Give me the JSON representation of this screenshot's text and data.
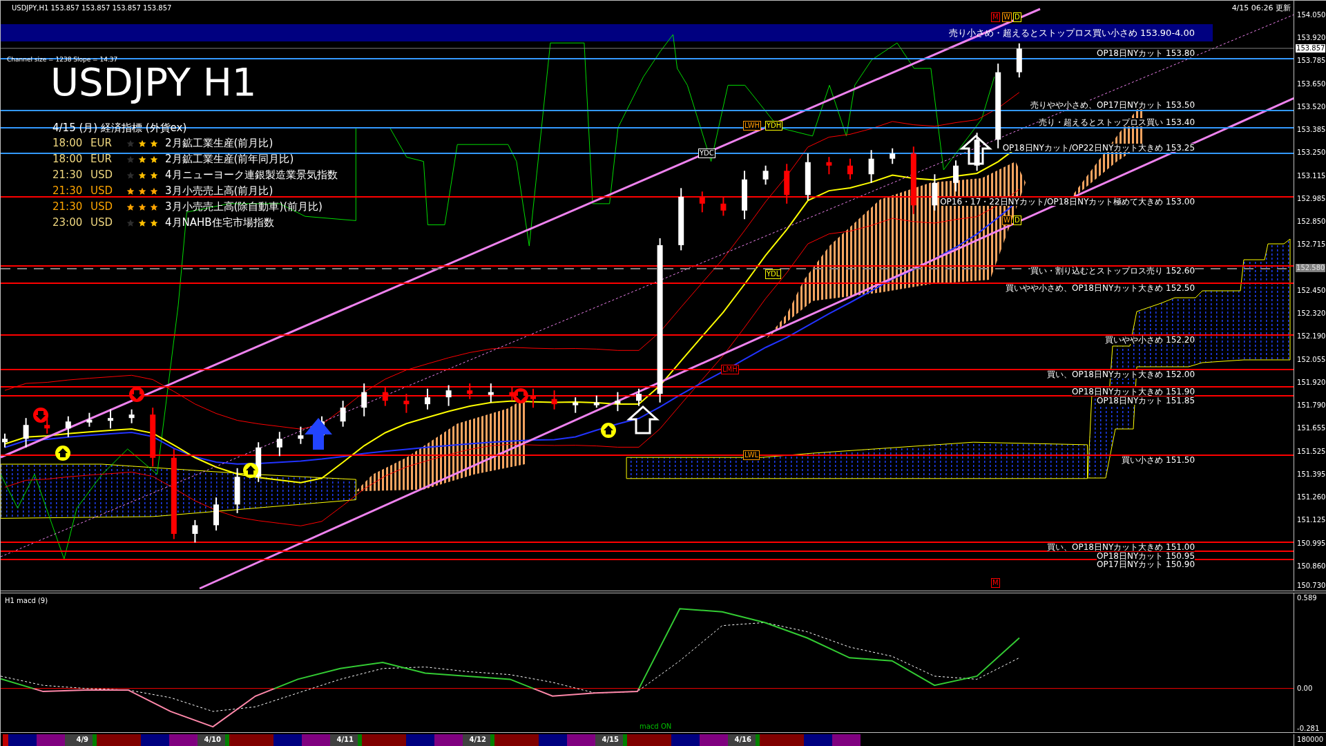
{
  "header": {
    "symbol_line": "USDJPY,H1  153.857 153.857 153.857 153.857",
    "updated": "4/15 06:26 更新",
    "channel_info": "Channel size = 1238 Slope = 14.37",
    "title": "USDJPY H1"
  },
  "events": {
    "heading": "4/15 (月) 経済指標 (外貨ex)",
    "rows": [
      {
        "time": "18:00",
        "currency": "EUR",
        "stars": 2,
        "name": "2月鉱工業生産(前月比)"
      },
      {
        "time": "18:00",
        "currency": "EUR",
        "stars": 2,
        "name": "2月鉱工業生産(前年同月比)"
      },
      {
        "time": "21:30",
        "currency": "USD",
        "stars": 2,
        "name": "4月ニューヨーク連銀製造業景気指数"
      },
      {
        "time": "21:30",
        "currency": "USD",
        "stars": 3,
        "name": "3月小売売上高(前月比)"
      },
      {
        "time": "21:30",
        "currency": "USD",
        "stars": 3,
        "name": "3月小売売上高(除自動車)(前月比)"
      },
      {
        "time": "23:00",
        "currency": "USD",
        "stars": 2,
        "name": "4月NAHB住宅市場指数"
      }
    ]
  },
  "price_chart": {
    "band": {
      "label": "売り小さめ・超えるとストップロス買い小さめ 153.90-4.00",
      "color": "#000080"
    },
    "levels": [
      {
        "label": "OP18日NYカット 153.80",
        "color": "#3399ff"
      },
      {
        "label": "売りやや小さめ、OP17日NYカット 153.50",
        "color": "#3399ff"
      },
      {
        "label": "売り・超えるとストップロス買い 153.40",
        "color": "#3399ff"
      },
      {
        "label": "OP18日NYカット/OP22日NYカット大きめ 153.25",
        "color": "#3399ff"
      },
      {
        "label": "OP16・17・22日NYカット/OP18日NYカット極めて大きめ 153.00",
        "color": "#ff0000"
      },
      {
        "label": "買い・割り込むとストップロス売り 152.60",
        "color": "#ff0000"
      },
      {
        "label": "買いやや小さめ、OP18日NYカット大きめ 152.50",
        "color": "#ff0000"
      },
      {
        "label": "買いやや小さめ 152.20",
        "color": "#ff0000"
      },
      {
        "label": "買い、OP18日NYカット大きめ 152.00",
        "color": "#ff0000"
      },
      {
        "label": "OP18日NYカット大きめ 151.90",
        "color": "#ff0000"
      },
      {
        "label": "OP18日NYカット 151.85",
        "color": "#ff0000"
      },
      {
        "label": "買い小さめ 151.50",
        "color": "#ff0000"
      },
      {
        "label": "買い、OP18日NYカット大きめ 151.00",
        "color": "#ff0000"
      },
      {
        "label": "OP18日NYカット 150.95",
        "color": "#ff0000"
      },
      {
        "label": "OP17日NYカット 150.90",
        "color": "#ff0000"
      }
    ],
    "tags": [
      {
        "text": "YDC",
        "color": "#ffffff"
      },
      {
        "text": "LWH",
        "color": "#ff9900"
      },
      {
        "text": "YDH",
        "color": "#ffff00"
      },
      {
        "text": "YDL",
        "color": "#ffff00"
      },
      {
        "text": "LMH",
        "color": "#ff0000"
      },
      {
        "text": "LWL",
        "color": "#ff9900"
      },
      {
        "text": "M",
        "color": "#ff0000"
      },
      {
        "text": "W",
        "color": "#ff9900"
      },
      {
        "text": "D",
        "color": "#ffff00"
      },
      {
        "text": "W",
        "color": "#ff9900"
      },
      {
        "text": "D",
        "color": "#ffff00"
      },
      {
        "text": "M",
        "color": "#ff0000"
      }
    ],
    "axis": {
      "ticks": [
        "154.050",
        "153.920",
        "153.785",
        "153.650",
        "153.520",
        "153.385",
        "153.250",
        "153.115",
        "152.985",
        "152.850",
        "152.715",
        "152.450",
        "152.320",
        "152.190",
        "152.055",
        "151.920",
        "151.790",
        "151.655",
        "151.525",
        "151.395",
        "151.260",
        "151.125",
        "150.995",
        "150.860",
        "150.730"
      ],
      "line_price": "152.580",
      "current_price": "153.857"
    }
  },
  "macd_panel": {
    "title": "H1  macd (9)",
    "status": "macd ON",
    "ticks": [
      "0.589",
      "0.00",
      "-0.281"
    ]
  },
  "date_bar": {
    "dates": [
      "4/9",
      "4/10",
      "4/11",
      "4/12",
      "4/15",
      "4/16"
    ],
    "scale_label": "180000"
  }
}
